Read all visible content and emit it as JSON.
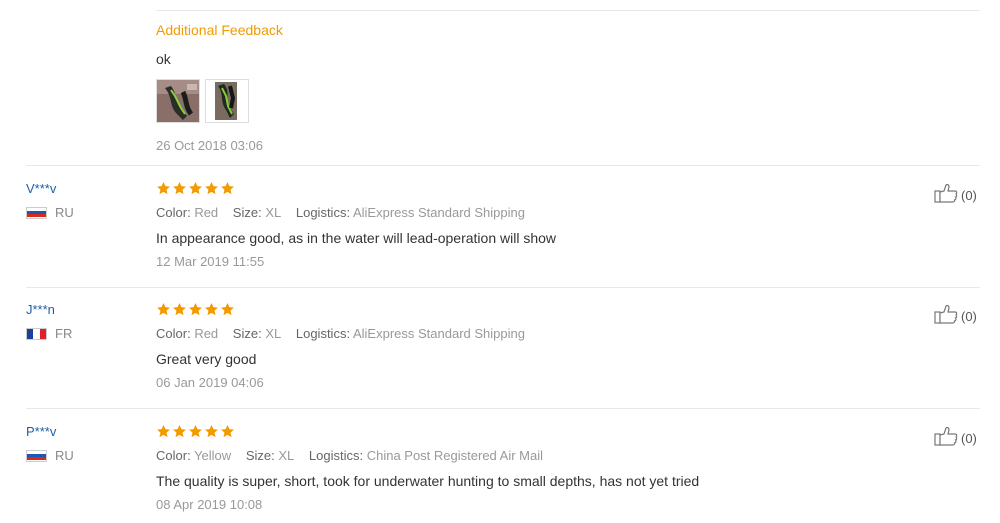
{
  "top_feedback": {
    "heading": "Additional Feedback",
    "text": "ok",
    "photos": [
      "photo-1",
      "photo-2"
    ],
    "date": "26 Oct 2018 03:06"
  },
  "labels": {
    "color": "Color:",
    "size": "Size:",
    "logistics": "Logistics:"
  },
  "reviews": [
    {
      "user": "V***v",
      "country": "RU",
      "rating": 5,
      "color": "Red",
      "size": "XL",
      "logistics": "AliExpress Standard Shipping",
      "text": "In appearance good, as in the water will lead-operation will show",
      "date": "12 Mar 2019 11:55",
      "likes": "(0)"
    },
    {
      "user": "J***n",
      "country": "FR",
      "rating": 5,
      "color": "Red",
      "size": "XL",
      "logistics": "AliExpress Standard Shipping",
      "text": "Great very good",
      "date": "06 Jan 2019 04:06",
      "likes": "(0)"
    },
    {
      "user": "P***v",
      "country": "RU",
      "rating": 5,
      "color": "Yellow",
      "size": "XL",
      "logistics": "China Post Registered Air Mail",
      "text": "The quality is super, short, took for underwater hunting to small depths, has not yet tried",
      "date": "08 Apr 2019 10:08",
      "likes": "(0)"
    }
  ],
  "colors": {
    "star": "#f29b00",
    "feedback_heading": "#f29b00",
    "username": "#1c5fa6"
  },
  "icons": {
    "star": "star-icon",
    "like": "thumbs-up-icon",
    "flag_ru": "russia-flag-icon",
    "flag_fr": "france-flag-icon"
  }
}
